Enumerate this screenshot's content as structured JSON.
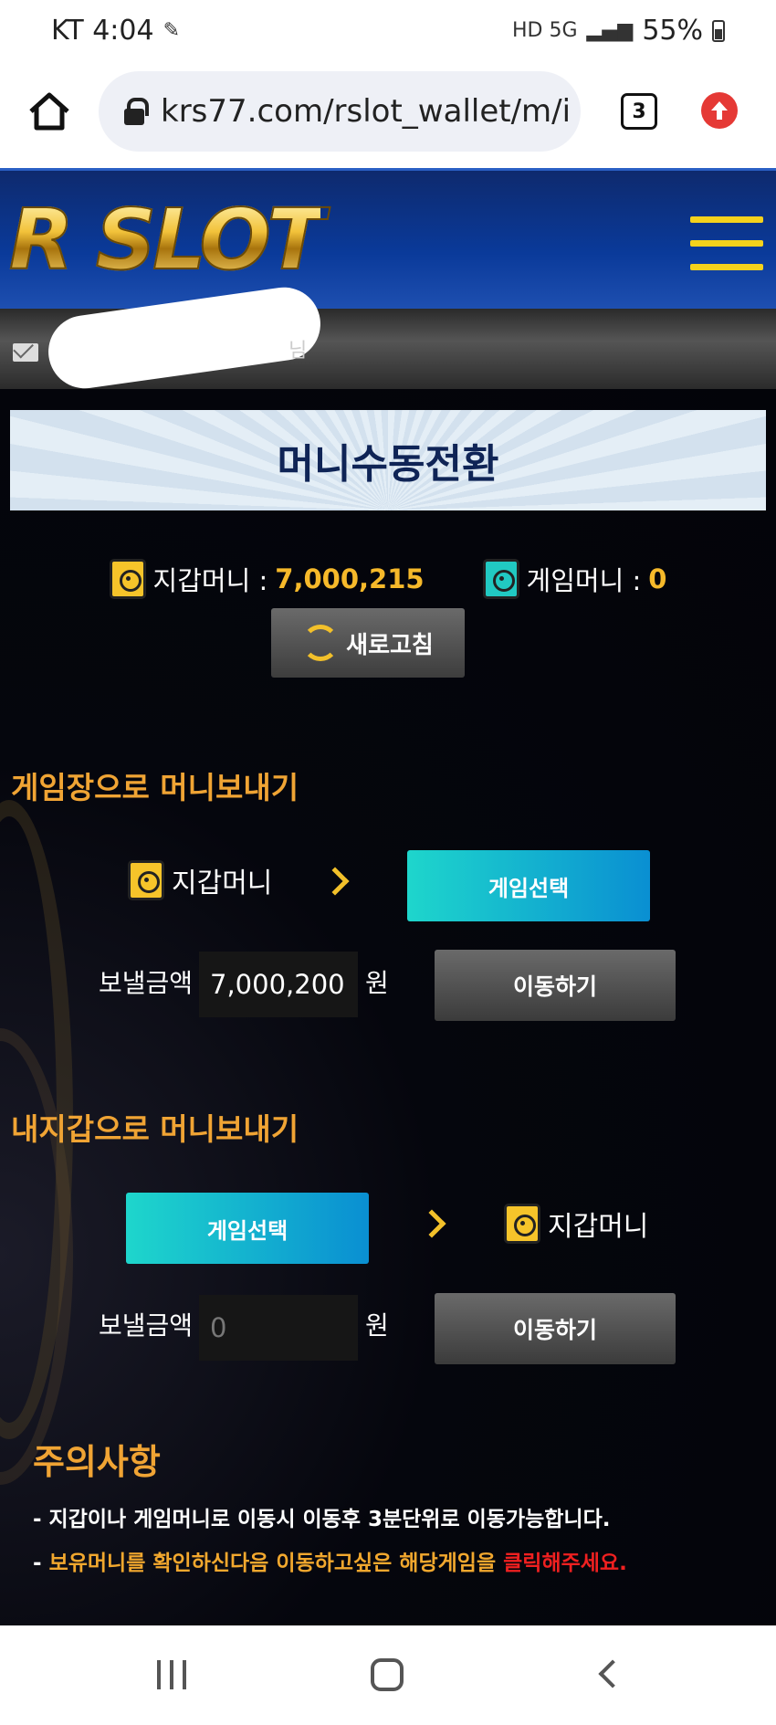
{
  "status_bar": {
    "carrier_time": "KT 4:04",
    "signal_text": "HD 5G",
    "battery": "55%"
  },
  "browser": {
    "url": "krs77.com/rslot_wallet/m/i",
    "tab_count": "3"
  },
  "site": {
    "logo": "R SLOT",
    "user_suffix": "님"
  },
  "page": {
    "title": "머니수동전환",
    "wallet_money_label": "지갑머니 : ",
    "wallet_money_value": "7,000,215",
    "game_money_label": "게임머니 : ",
    "game_money_value": "0",
    "refresh_label": "새로고침"
  },
  "send_to_game": {
    "section_title": "게임장으로 머니보내기",
    "from_label": "지갑머니",
    "game_select_label": "게임선택",
    "amount_label": "보낼금액",
    "amount_value": "7,000,200",
    "currency": "원",
    "move_label": "이동하기"
  },
  "send_to_wallet": {
    "section_title": "내지갑으로 머니보내기",
    "game_select_label": "게임선택",
    "to_label": "지갑머니",
    "amount_label": "보낼금액",
    "amount_placeholder": "0",
    "currency": "원",
    "move_label": "이동하기"
  },
  "notice": {
    "title": "주의사항",
    "line1": "- 지갑이나 게임머니로 이동시 이동후 3분단위로 이동가능합니다.",
    "line2_prefix": "- ",
    "line2_orange": "보유머니를 확인하신다음 이동하고싶은 해당게임을 ",
    "line2_red": "클릭해주세요."
  },
  "colors": {
    "accent_gold": "#f2c02a",
    "section_orange": "#f0a434",
    "game_button_gradient": [
      "#1ed6cc",
      "#0a8fd2"
    ],
    "warning_red": "#f02020"
  }
}
